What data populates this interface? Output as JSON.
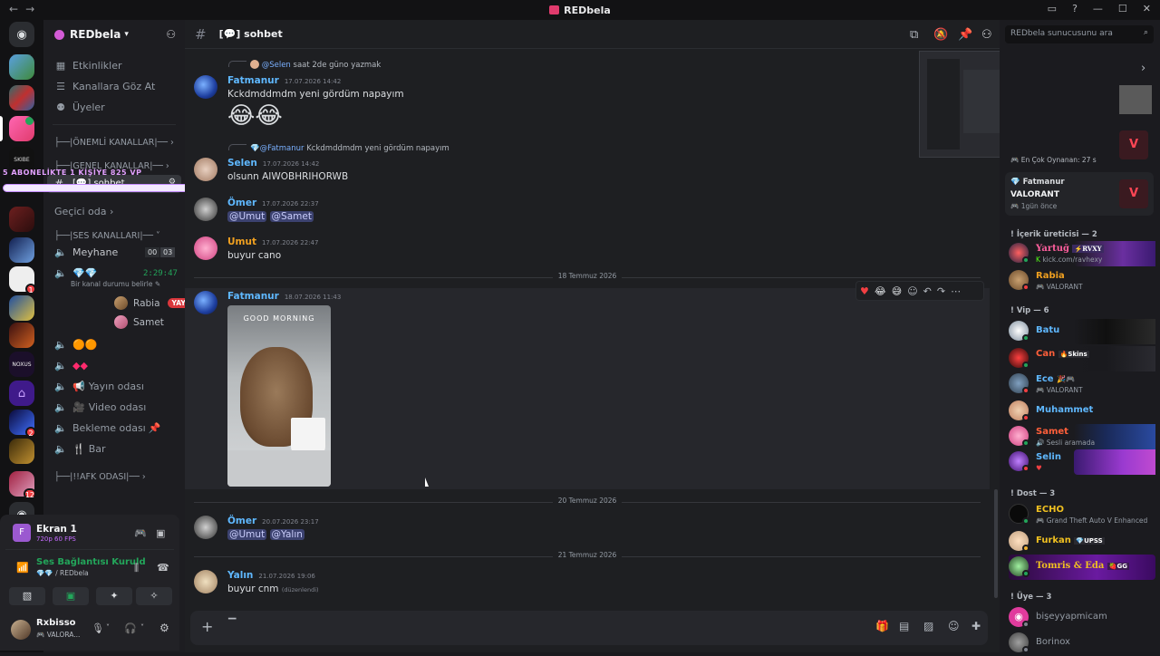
{
  "window": {
    "title": "REDbela"
  },
  "servers": {
    "home_label": "Discord",
    "dm_badges": [
      {
        "count": "1"
      },
      {
        "count": "2"
      },
      {
        "count": "12"
      }
    ]
  },
  "guild": {
    "name": "REDbela"
  },
  "sidebar": {
    "top_items": [
      {
        "icon": "calendar-icon",
        "label": "Etkinlikler"
      },
      {
        "icon": "browse-icon",
        "label": "Kanallara Göz At"
      },
      {
        "icon": "members-icon",
        "label": "Üyeler"
      }
    ],
    "categories": {
      "important": "├──|ÖNEMLİ KANALLAR|──",
      "general": "├──|GENEL KANALLAR|──",
      "voice": "├──|SES KANALLARI|──",
      "afk": "├──|!!AFK ODASI|──"
    },
    "selected_channel": "sohbet",
    "passing_room": "Geçici oda",
    "voice_channels": [
      {
        "label": "Meyhane",
        "counts": [
          "00",
          "03"
        ]
      },
      {
        "label": "",
        "timer": "2:29:47",
        "status": "Bir kanal durumu belirle"
      },
      {
        "label": ""
      },
      {
        "label": ""
      },
      {
        "label": "Yayın odası"
      },
      {
        "label": "Video odası"
      },
      {
        "label": "Bekleme odası"
      },
      {
        "label": "Bar"
      }
    ],
    "voice_users": [
      {
        "name": "Rabia",
        "live": "YAYINDA"
      },
      {
        "name": "Samet"
      }
    ],
    "overlay_banner": "5 ABONELİKTE 1 KİŞİYE 825 VP"
  },
  "panel": {
    "stream_title": "Ekran 1",
    "stream_quality": "720p 60 FPS",
    "voice_status": "Ses Bağlantısı Kuruld",
    "voice_location": "/ REDbela",
    "user_name": "Rxbisso",
    "user_status": "VALORA..."
  },
  "channel": {
    "name": "sohbet"
  },
  "messages": [
    {
      "reply_to": "@Selen",
      "reply_text": "saat 2de güno yazmak",
      "author": "Fatmanur",
      "time": "17.07.2026 14:42",
      "text": "Kckdmddmdm yeni gördüm napayım",
      "emoji": "😂😂"
    },
    {
      "reply_to": "@Fatmanur",
      "reply_text": "Kckdmddmdm yeni gördüm napayım",
      "author": "Selen",
      "time": "17.07.2026 14:42",
      "text": "olsunn AIWOBHRIHORWB"
    },
    {
      "author": "Ömer",
      "time": "17.07.2026 22:37",
      "mentions": [
        "@Umut",
        "@Samet"
      ]
    },
    {
      "author": "Umut",
      "time": "17.07.2026 22:47",
      "text": "buyur cano"
    },
    {
      "author": "Fatmanur",
      "time": "18.07.2026 11:43",
      "image_caption": "GOOD MORNING"
    },
    {
      "author": "Ömer",
      "time": "20.07.2026 23:17",
      "mentions": [
        "@Umut",
        "@Yalın"
      ]
    },
    {
      "author": "Yalın",
      "time": "21.07.2026 19:06",
      "text": "buyur cnm",
      "edited": "(düzenlendi)"
    }
  ],
  "dividers": [
    "18 Temmuz 2026",
    "20 Temmuz 2026",
    "21 Temmuz 2026"
  ],
  "members": {
    "search_placeholder": "REDbela sunucusunu ara",
    "activity_top": "En Çok Oynanan: 27 s",
    "activity_card": {
      "name": "Fatmanur",
      "game": "VALORANT",
      "ago": "1gün önce"
    },
    "sections": [
      {
        "title": "! İçerik üreticisi — 2",
        "members": [
          {
            "name": "Yartuğ",
            "tag": "RVXY",
            "status": "kick.com/ravhexy"
          },
          {
            "name": "Rabia",
            "status": "VALORANT"
          }
        ]
      },
      {
        "title": "! Vip — 6",
        "members": [
          {
            "name": "Batu"
          },
          {
            "name": "Can",
            "tag": "Skins"
          },
          {
            "name": "Ece",
            "status": "VALORANT"
          },
          {
            "name": "Muhammet"
          },
          {
            "name": "Samet",
            "status": "Sesli aramada"
          },
          {
            "name": "Selin"
          }
        ]
      },
      {
        "title": "! Dost — 3",
        "members": [
          {
            "name": "ECHO",
            "status": "Grand Theft Auto V Enhanced"
          },
          {
            "name": "Furkan",
            "tag": "UPSS"
          },
          {
            "name": "Tomris & Eda",
            "tag": "GG"
          }
        ]
      },
      {
        "title": "! Üye — 3",
        "members": [
          {
            "name": "bişeyyapmicam"
          },
          {
            "name": "Borinox"
          }
        ]
      }
    ]
  },
  "colors": {
    "accent": "#5865f2",
    "live": "#da373c",
    "online": "#23a55a",
    "dnd": "#f23f42",
    "mention_bg": "#3c4270"
  }
}
